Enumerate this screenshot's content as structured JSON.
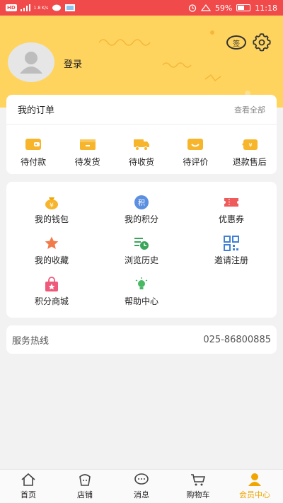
{
  "status_bar": {
    "signal": "HD",
    "speed": "1.8 K/s",
    "battery": "59%",
    "time": "11:18"
  },
  "profile": {
    "login_label": "登录",
    "sign_label": "签"
  },
  "orders": {
    "title": "我的订单",
    "view_all": "查看全部",
    "items": [
      {
        "label": "待付款",
        "icon": "wallet-icon"
      },
      {
        "label": "待发货",
        "icon": "box-icon"
      },
      {
        "label": "待收货",
        "icon": "truck-icon"
      },
      {
        "label": "待评价",
        "icon": "review-icon"
      },
      {
        "label": "退款售后",
        "icon": "refund-icon"
      }
    ]
  },
  "services": {
    "items": [
      {
        "label": "我的钱包",
        "icon": "money-bag-icon"
      },
      {
        "label": "我的积分",
        "icon": "points-icon",
        "glyph": "积"
      },
      {
        "label": "优惠券",
        "icon": "coupon-icon"
      },
      {
        "label": "我的收藏",
        "icon": "star-icon"
      },
      {
        "label": "浏览历史",
        "icon": "history-icon"
      },
      {
        "label": "邀请注册",
        "icon": "qr-code-icon"
      },
      {
        "label": "积分商城",
        "icon": "shopping-bag-icon"
      },
      {
        "label": "帮助中心",
        "icon": "lightbulb-icon"
      }
    ]
  },
  "hotline": {
    "label": "服务热线",
    "number": "025-86800885"
  },
  "tabbar": {
    "tabs": [
      {
        "label": "首页",
        "icon": "home-icon"
      },
      {
        "label": "店铺",
        "icon": "store-icon"
      },
      {
        "label": "消息",
        "icon": "message-icon"
      },
      {
        "label": "购物车",
        "icon": "cart-icon"
      },
      {
        "label": "会员中心",
        "icon": "member-icon",
        "active": true
      }
    ]
  },
  "colors": {
    "header": "#ffd45e",
    "accent": "#f0a500",
    "status_bar": "#f04a4a"
  }
}
